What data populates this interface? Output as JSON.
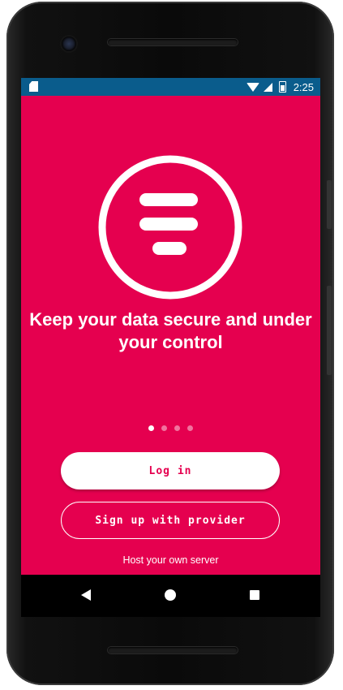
{
  "status_bar": {
    "time": "2:25",
    "background": "#0a5c8c",
    "icons": [
      "sd-card-icon",
      "wifi-icon",
      "signal-icon",
      "battery-charging-icon"
    ]
  },
  "onboarding": {
    "background": "#e5004f",
    "logo": "app-logo-icon",
    "headline": "Keep your data secure and under your control",
    "page_indicator": {
      "count": 4,
      "active": 1
    }
  },
  "actions": {
    "login_label": "Log in",
    "signup_label": "Sign up with provider",
    "host_label": "Host your own server"
  },
  "nav_bar": {
    "icons": [
      "back-icon",
      "home-icon",
      "recents-icon"
    ]
  }
}
